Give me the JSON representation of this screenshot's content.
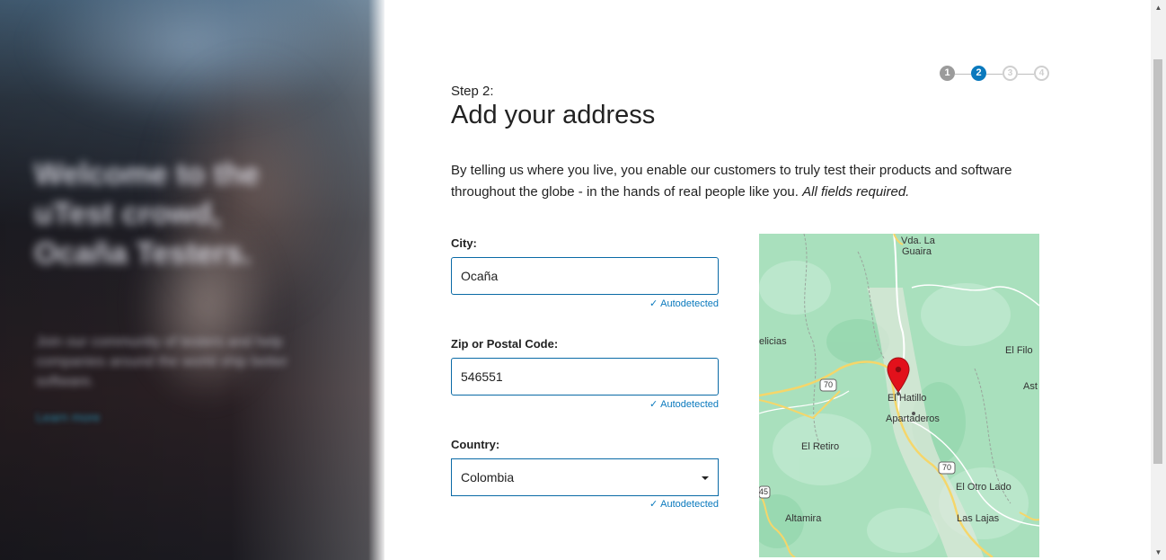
{
  "hero": {
    "title": "Welcome to the uTest crowd, Ocaña Testers.",
    "body": "Join our community of testers and help companies around the world ship better software.",
    "link": "Learn more"
  },
  "stepper": {
    "steps": [
      "1",
      "2",
      "3",
      "4"
    ],
    "current": 2
  },
  "form": {
    "step_label": "Step 2:",
    "title": "Add your address",
    "intro": "By telling us where you live, you enable our customers to truly test their products and software throughout the globe - in the hands of real people like you.",
    "intro_emphasis": "All fields required.",
    "city": {
      "label": "City:",
      "value": "Ocaña",
      "status": "Autodetected"
    },
    "zip": {
      "label": "Zip or Postal Code:",
      "value": "546551",
      "status": "Autodetected"
    },
    "country": {
      "label": "Country:",
      "value": "Colombia",
      "status": "Autodetected"
    }
  },
  "map": {
    "labels": {
      "vda": "Vda. La",
      "guaira": "Guaira",
      "elicias": "elicias",
      "el_filo": "El Filo",
      "el_hatillo": "El Hatillo",
      "ast": "Ast",
      "apartaderos": "Apartaderos",
      "el_retiro": "El Retiro",
      "el_otro_lado": "El Otro Lado",
      "altamira": "Altamira",
      "las_lajas": "Las Lajas",
      "route_70a": "70",
      "route_70b": "70",
      "route_45": "45"
    },
    "pin_color": "#e2111b"
  },
  "colors": {
    "accent": "#0a79bd",
    "map_green": "#a9e0bd"
  }
}
